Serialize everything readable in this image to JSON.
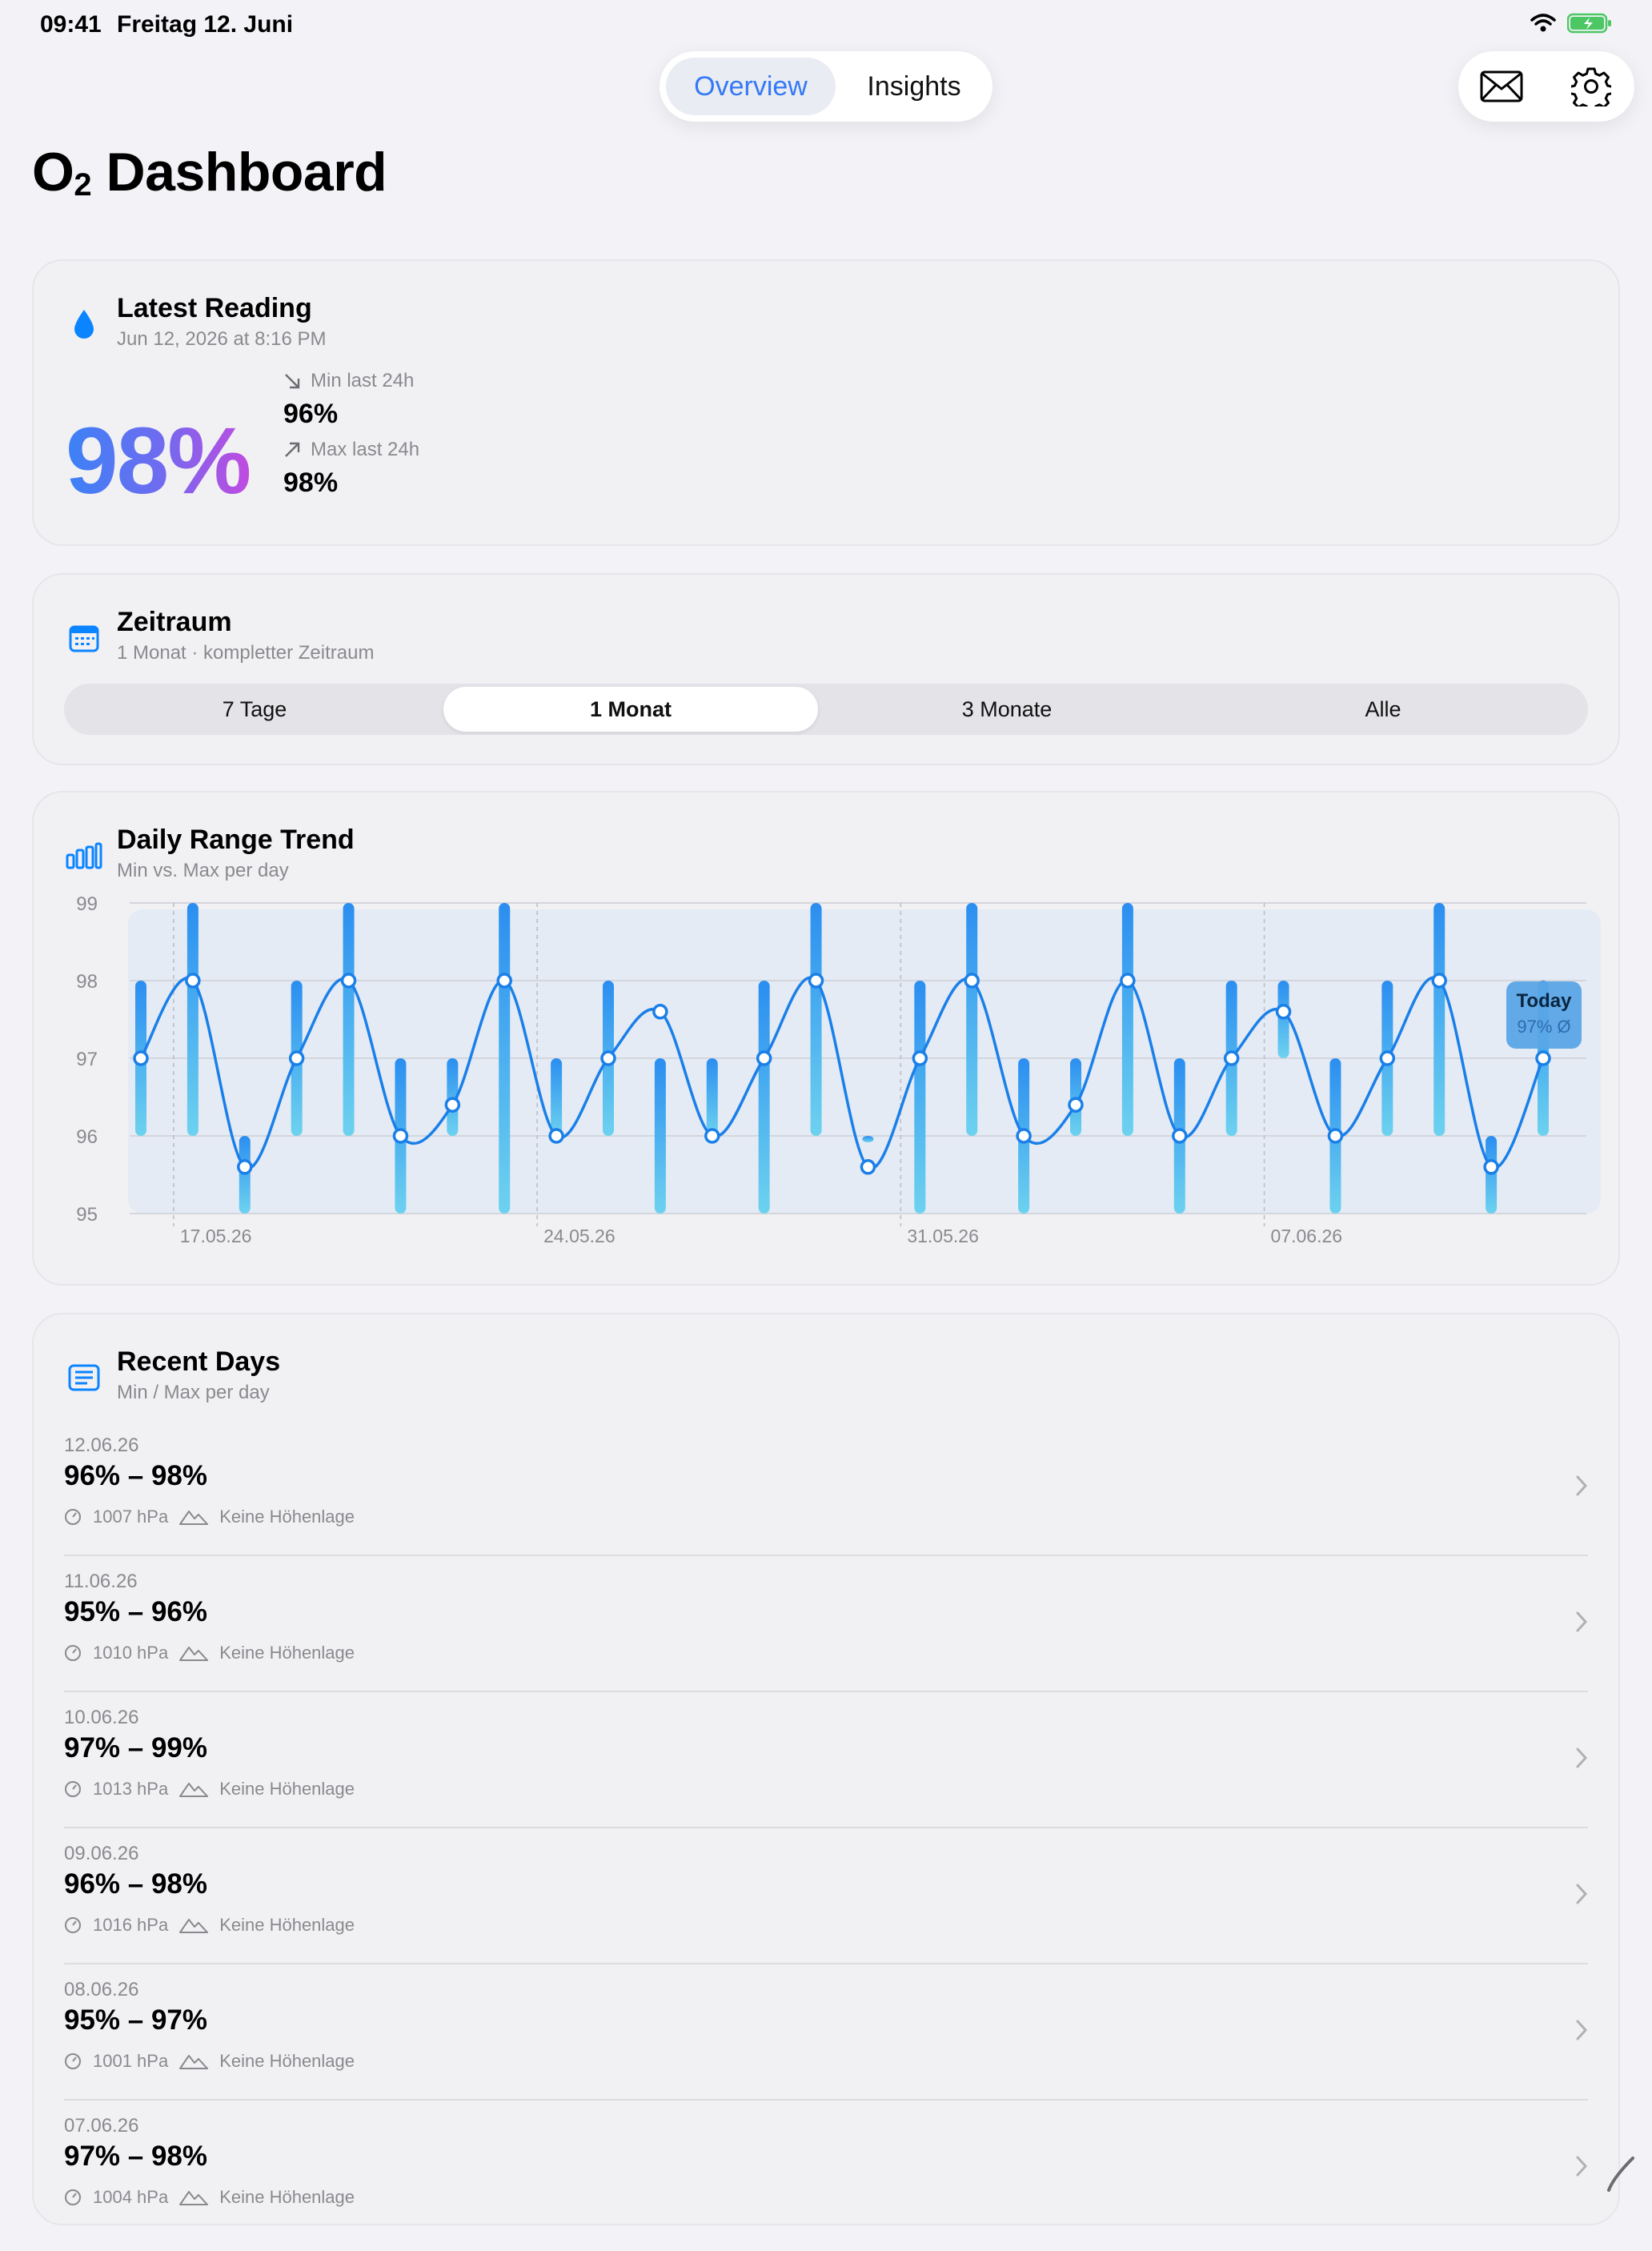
{
  "status": {
    "time": "09:41",
    "date": "Freitag 12. Juni"
  },
  "nav": {
    "tabs": [
      "Overview",
      "Insights"
    ],
    "selected": "Overview"
  },
  "toolbar": {
    "mail_icon": "envelope-icon",
    "settings_icon": "gear-icon"
  },
  "page": {
    "title_main": "O",
    "title_sub": "2",
    "title_rest": " Dashboard"
  },
  "latest": {
    "title": "Latest Reading",
    "timestamp": "Jun 12, 2026 at 8:16 PM",
    "value": "98%",
    "min_label": "Min last 24h",
    "min_value": "96%",
    "max_label": "Max last 24h",
    "max_value": "98%"
  },
  "range": {
    "title": "Zeitraum",
    "subtitle": "1 Monat · kompletter Zeitraum",
    "options": [
      "7 Tage",
      "1 Monat",
      "3 Monate",
      "Alle"
    ],
    "selected_index": 1
  },
  "trend": {
    "title": "Daily Range Trend",
    "subtitle": "Min vs. Max per day",
    "tooltip_title": "Today",
    "tooltip_value": "97% Ø"
  },
  "chart_data": {
    "type": "bar",
    "y_ticks": [
      "99",
      "98",
      "97",
      "96",
      "95"
    ],
    "ylim": [
      95,
      99
    ],
    "x_tick_labels": [
      "17.05.26",
      "24.05.26",
      "31.05.26",
      "07.06.26"
    ],
    "x_tick_day_index": [
      1,
      8,
      15,
      22
    ],
    "days": 28,
    "min": [
      96,
      96,
      95,
      96,
      96,
      95,
      96,
      95,
      96,
      96,
      95,
      96,
      95,
      96,
      96,
      95,
      96,
      95,
      96,
      96,
      95,
      96,
      97,
      95,
      96,
      96,
      95,
      96
    ],
    "max": [
      98,
      99,
      96,
      98,
      99,
      97,
      97,
      99,
      97,
      98,
      97,
      97,
      98,
      99,
      96,
      98,
      99,
      97,
      97,
      99,
      97,
      98,
      98,
      97,
      98,
      99,
      96,
      98
    ],
    "avg": [
      97,
      98,
      95.6,
      97,
      98,
      96,
      96.4,
      98,
      96,
      97,
      97.6,
      96,
      97,
      98,
      95.6,
      97,
      98,
      96,
      96.4,
      98,
      96,
      97,
      97.6,
      96,
      97,
      98,
      95.6,
      97
    ],
    "colors": {
      "bar_top": "#2b8ef0",
      "bar_bottom": "#6dd2ef",
      "line": "#1a7fe8"
    }
  },
  "recent": {
    "title": "Recent Days",
    "subtitle": "Min / Max per day",
    "rows": [
      {
        "date": "12.06.26",
        "range": "96% – 98%",
        "pressure": "1007 hPa",
        "altitude": "Keine Höhenlage"
      },
      {
        "date": "11.06.26",
        "range": "95% – 96%",
        "pressure": "1010 hPa",
        "altitude": "Keine Höhenlage"
      },
      {
        "date": "10.06.26",
        "range": "97% – 99%",
        "pressure": "1013 hPa",
        "altitude": "Keine Höhenlage"
      },
      {
        "date": "09.06.26",
        "range": "96% – 98%",
        "pressure": "1016 hPa",
        "altitude": "Keine Höhenlage"
      },
      {
        "date": "08.06.26",
        "range": "95% – 97%",
        "pressure": "1001 hPa",
        "altitude": "Keine Höhenlage"
      },
      {
        "date": "07.06.26",
        "range": "97% – 98%",
        "pressure": "1004 hPa",
        "altitude": "Keine Höhenlage"
      }
    ]
  },
  "colors": {
    "accent": "#3478f6",
    "background": "#f2f2f7"
  }
}
